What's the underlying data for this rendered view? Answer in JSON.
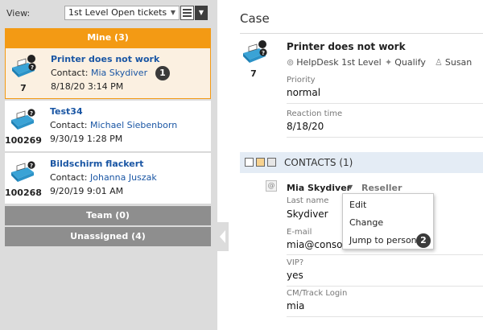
{
  "sidebar": {
    "view_label": "View:",
    "view_select_value": "1st Level Open tickets",
    "groups": {
      "mine": "Mine (3)",
      "team": "Team (0)",
      "unassigned": "Unassigned (4)"
    },
    "tickets": [
      {
        "number": "7",
        "title": "Printer does not work",
        "contact_prefix": "Contact: ",
        "contact_name": "Mia Skydiver",
        "date": "8/18/20 3:14 PM",
        "badge": "1"
      },
      {
        "number": "100269",
        "title": "Test34",
        "contact_prefix": "Contact: ",
        "contact_name": "Michael Siebenborn",
        "date": "9/30/19 1:28 PM"
      },
      {
        "number": "100268",
        "title": "Bildschirm flackert",
        "contact_prefix": "Contact: ",
        "contact_name": "Johanna Juszak",
        "date": "9/20/19 9:01 AM"
      }
    ]
  },
  "case": {
    "header": "Case",
    "number": "7",
    "title": "Printer does not work",
    "meta": {
      "queue": "HelpDesk 1st Level",
      "status": "Qualify",
      "owner": "Susan"
    },
    "fields": {
      "priority_label": "Priority",
      "priority_value": "normal",
      "reaction_label": "Reaction time",
      "reaction_value": "8/18/20"
    }
  },
  "contacts": {
    "title": "CONTACTS (1)",
    "name": "Mia Skydiver",
    "role": "Reseller",
    "fields": {
      "lastname_label": "Last name",
      "lastname_value": "Skydiver",
      "email_label": "E-mail",
      "email_value": "mia@consol",
      "vip_label": "VIP?",
      "vip_value": "yes",
      "login_label": "CM/Track Login",
      "login_value": "mia"
    },
    "menu": {
      "edit": "Edit",
      "change": "Change",
      "jump": "Jump to person",
      "badge": "2"
    }
  },
  "colors": {
    "accent_orange": "#f39a14",
    "group_gray": "#8e8e8e",
    "link_blue": "#1a56a4",
    "contacts_bar": "#e4ecf5"
  }
}
